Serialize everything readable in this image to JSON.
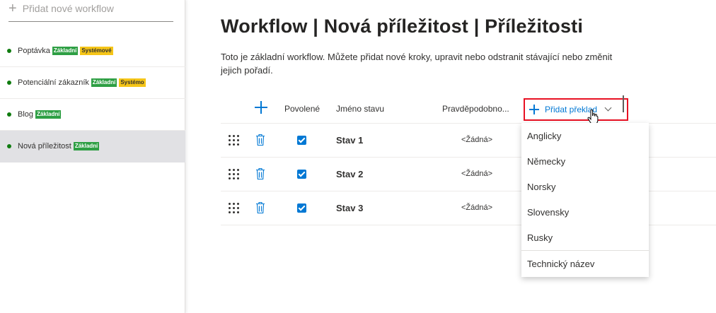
{
  "sidebar": {
    "add_workflow_label": "Přidat nové workflow",
    "items": [
      {
        "label": "Poptávka",
        "badges": [
          {
            "text": "Základní",
            "color": "green"
          },
          {
            "text": "Systémové",
            "color": "yellow"
          }
        ],
        "active": false
      },
      {
        "label": "Potenciální zákazník",
        "badges": [
          {
            "text": "Základní",
            "color": "green"
          },
          {
            "text": "Systémo",
            "color": "yellow"
          }
        ],
        "active": false
      },
      {
        "label": "Blog",
        "badges": [
          {
            "text": "Základní",
            "color": "green"
          }
        ],
        "active": false
      },
      {
        "label": "Nová příležitost",
        "badges": [
          {
            "text": "Základní",
            "color": "green"
          }
        ],
        "active": true
      }
    ]
  },
  "main": {
    "title": "Workflow | Nová příležitost | Příležitosti",
    "description": "Toto je základní workflow. Můžete přidat nové kroky, upravit nebo odstranit stávající nebo změnit jejich pořadí.",
    "table": {
      "headers": {
        "enabled": "Povolené",
        "state_name": "Jméno stavu",
        "probability": "Pravděpodobno..."
      },
      "add_translation_label": "Přidat překlad",
      "rows": [
        {
          "state": "Stav 1",
          "probability": "<Žádná>",
          "enabled": true
        },
        {
          "state": "Stav 2",
          "probability": "<Žádná>",
          "enabled": true
        },
        {
          "state": "Stav 3",
          "probability": "<Žádná>",
          "enabled": true
        }
      ]
    },
    "dropdown": {
      "languages": [
        "Anglicky",
        "Německy",
        "Norsky",
        "Slovensky",
        "Rusky"
      ],
      "technical_name": "Technický název"
    }
  },
  "colors": {
    "accent": "#0078d4",
    "green_badge": "#2e9f44",
    "yellow_badge": "#f5c518",
    "highlight_border": "#e81123",
    "status_dot": "#107c10"
  }
}
